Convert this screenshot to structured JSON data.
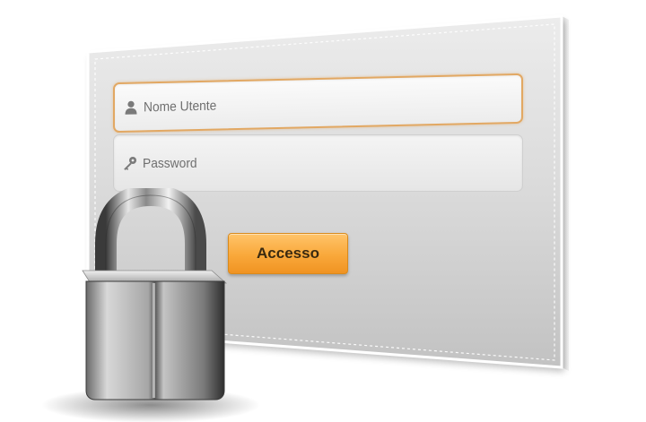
{
  "login_form": {
    "username_placeholder": "Nome Utente",
    "password_placeholder": "Password",
    "submit_label": "Accesso"
  },
  "icons": {
    "username": "user-icon",
    "password": "key-icon",
    "decoration": "padlock-icon"
  },
  "colors": {
    "focus_border": "#e2a863",
    "button": "#f9a83a",
    "card_top": "#e6e6e6",
    "card_bottom": "#c4c4c4"
  }
}
